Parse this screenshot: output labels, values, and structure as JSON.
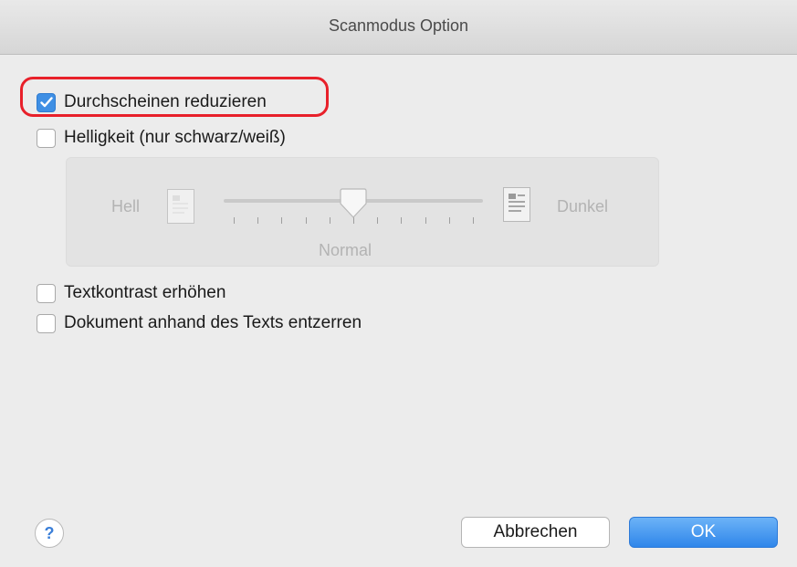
{
  "window": {
    "title": "Scanmodus Option"
  },
  "options": {
    "reduce_bleed_through": {
      "label": "Durchscheinen reduzieren",
      "checked": true
    },
    "brightness": {
      "label": "Helligkeit (nur schwarz/weiß)",
      "checked": false
    },
    "text_contrast": {
      "label": "Textkontrast erhöhen",
      "checked": false
    },
    "deskew_by_text": {
      "label": "Dokument anhand des Texts entzerren",
      "checked": false
    }
  },
  "brightness_panel": {
    "label_light": "Hell",
    "label_dark": "Dunkel",
    "label_normal": "Normal",
    "enabled": false,
    "slider": {
      "tick_count": 11,
      "value_index": 5
    }
  },
  "footer": {
    "help_label": "?",
    "cancel_label": "Abbrechen",
    "ok_label": "OK"
  },
  "colors": {
    "accent": "#3f8fe4",
    "highlight": "#e8202a"
  }
}
